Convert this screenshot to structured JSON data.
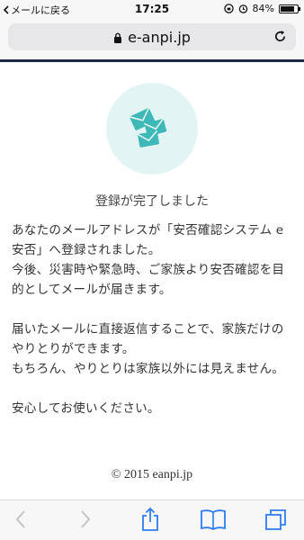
{
  "status_bar": {
    "back_app_label": "メールに戻る",
    "time": "17:25",
    "battery": "84%",
    "battery_level": 0.84
  },
  "browser": {
    "url": "e-anpi.jp"
  },
  "page": {
    "completed_title": "登録が完了しました",
    "paragraphs": [
      "あなたのメールアドレスが「安否確認システム e安否」へ登録されました。",
      "今後、災害時や緊急時、ご家族より安否確認を目的としてメールが届きます。",
      "届いたメールに直接返信することで、家族だけのやりとりができます。",
      "もちろん、やりとりは家族以外には見えません。",
      "安心してお使いください。"
    ],
    "footer": "© 2015 eanpi.jp"
  },
  "colors": {
    "accent": "#3fb8b8",
    "header_rule": "#1e2a4a",
    "icon_bg": "#e3f4f4",
    "toolbar_icon": "#2e7cf6"
  },
  "icons": [
    "back-icon",
    "lock-icon",
    "reload-icon",
    "envelopes-icon",
    "back-arrow-icon",
    "forward-arrow-icon",
    "share-icon",
    "bookmarks-icon",
    "tabs-icon"
  ]
}
